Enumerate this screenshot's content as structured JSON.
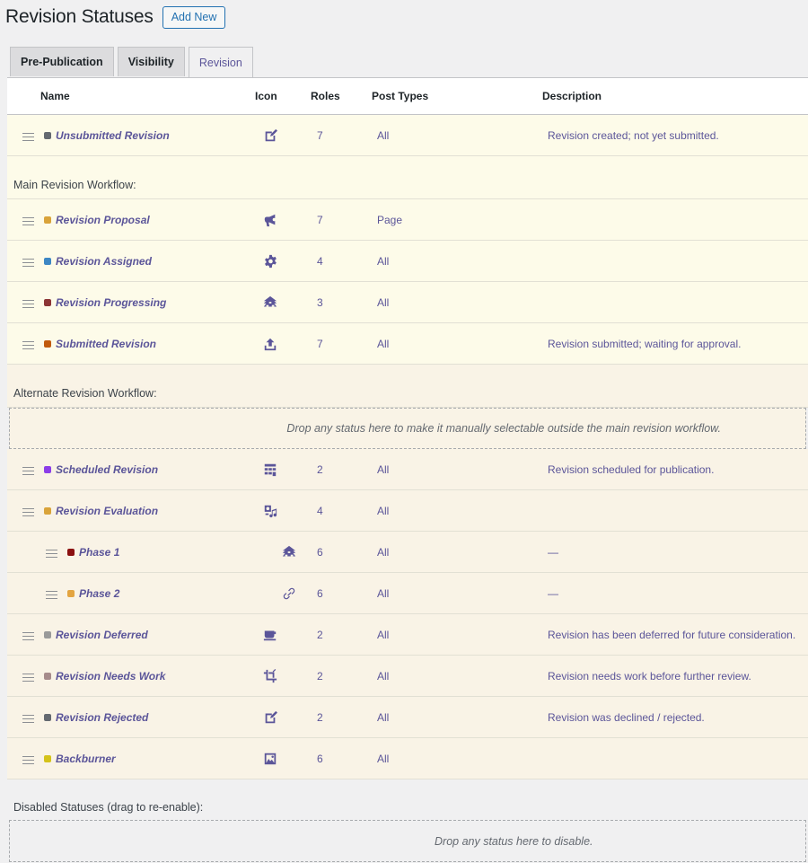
{
  "header": {
    "title": "Revision Statuses",
    "add_new": "Add New"
  },
  "tabs": [
    {
      "label": "Pre-Publication"
    },
    {
      "label": "Visibility"
    },
    {
      "label": "Revision"
    }
  ],
  "columns": {
    "name": "Name",
    "icon": "Icon",
    "roles": "Roles",
    "post_types": "Post Types",
    "description": "Description"
  },
  "first_row": {
    "name": "Unsubmitted Revision",
    "color": "#646970",
    "icon": "edit-icon",
    "roles": "7",
    "post_types": "All",
    "description": "Revision created; not yet submitted."
  },
  "main_workflow": {
    "label": "Main Revision Workflow:",
    "rows": [
      {
        "name": "Revision Proposal",
        "color": "#d9a33a",
        "icon": "megaphone-icon",
        "roles": "7",
        "post_types": "Page",
        "description": ""
      },
      {
        "name": "Revision Assigned",
        "color": "#3d87c4",
        "icon": "gear-icon",
        "roles": "4",
        "post_types": "All",
        "description": ""
      },
      {
        "name": "Revision Progressing",
        "color": "#8c3535",
        "icon": "hierarchy-icon",
        "roles": "3",
        "post_types": "All",
        "description": ""
      },
      {
        "name": "Submitted Revision",
        "color": "#c15a0c",
        "icon": "upload-icon",
        "roles": "7",
        "post_types": "All",
        "description": "Revision submitted; waiting for approval."
      }
    ]
  },
  "alternate_workflow": {
    "label": "Alternate Revision Workflow:",
    "drop_message": "Drop any status here to make it manually selectable outside the main revision workflow.",
    "rows": [
      {
        "name": "Scheduled Revision",
        "color": "#8c3ee8",
        "icon": "schedule-icon",
        "roles": "2",
        "post_types": "All",
        "description": "Revision scheduled for publication.",
        "child": false
      },
      {
        "name": "Revision Evaluation",
        "color": "#d9a33a",
        "icon": "media-interactive-icon",
        "roles": "4",
        "post_types": "All",
        "description": "",
        "child": false
      },
      {
        "name": "Phase 1",
        "color": "#8b1010",
        "icon": "hierarchy-icon",
        "roles": "6",
        "post_types": "All",
        "description": "—",
        "child": true
      },
      {
        "name": "Phase 2",
        "color": "#e3a440",
        "icon": "link-icon",
        "roles": "6",
        "post_types": "All",
        "description": "—",
        "child": true
      },
      {
        "name": "Revision Deferred",
        "color": "#9a9a9a",
        "icon": "coffee-icon",
        "roles": "2",
        "post_types": "All",
        "description": "Revision has been deferred for future consideration.",
        "child": false
      },
      {
        "name": "Revision Needs Work",
        "color": "#a68b8b",
        "icon": "crop-icon",
        "roles": "2",
        "post_types": "All",
        "description": "Revision needs work before further review.",
        "child": false
      },
      {
        "name": "Revision Rejected",
        "color": "#646970",
        "icon": "edit-icon",
        "roles": "2",
        "post_types": "All",
        "description": "Revision was declined / rejected.",
        "child": false
      },
      {
        "name": "Backburner",
        "color": "#d4c21a",
        "icon": "image-icon",
        "roles": "6",
        "post_types": "All",
        "description": "",
        "child": false
      }
    ]
  },
  "disabled": {
    "label": "Disabled Statuses (drag to re-enable):",
    "drop_message": "Drop any status here to disable."
  }
}
